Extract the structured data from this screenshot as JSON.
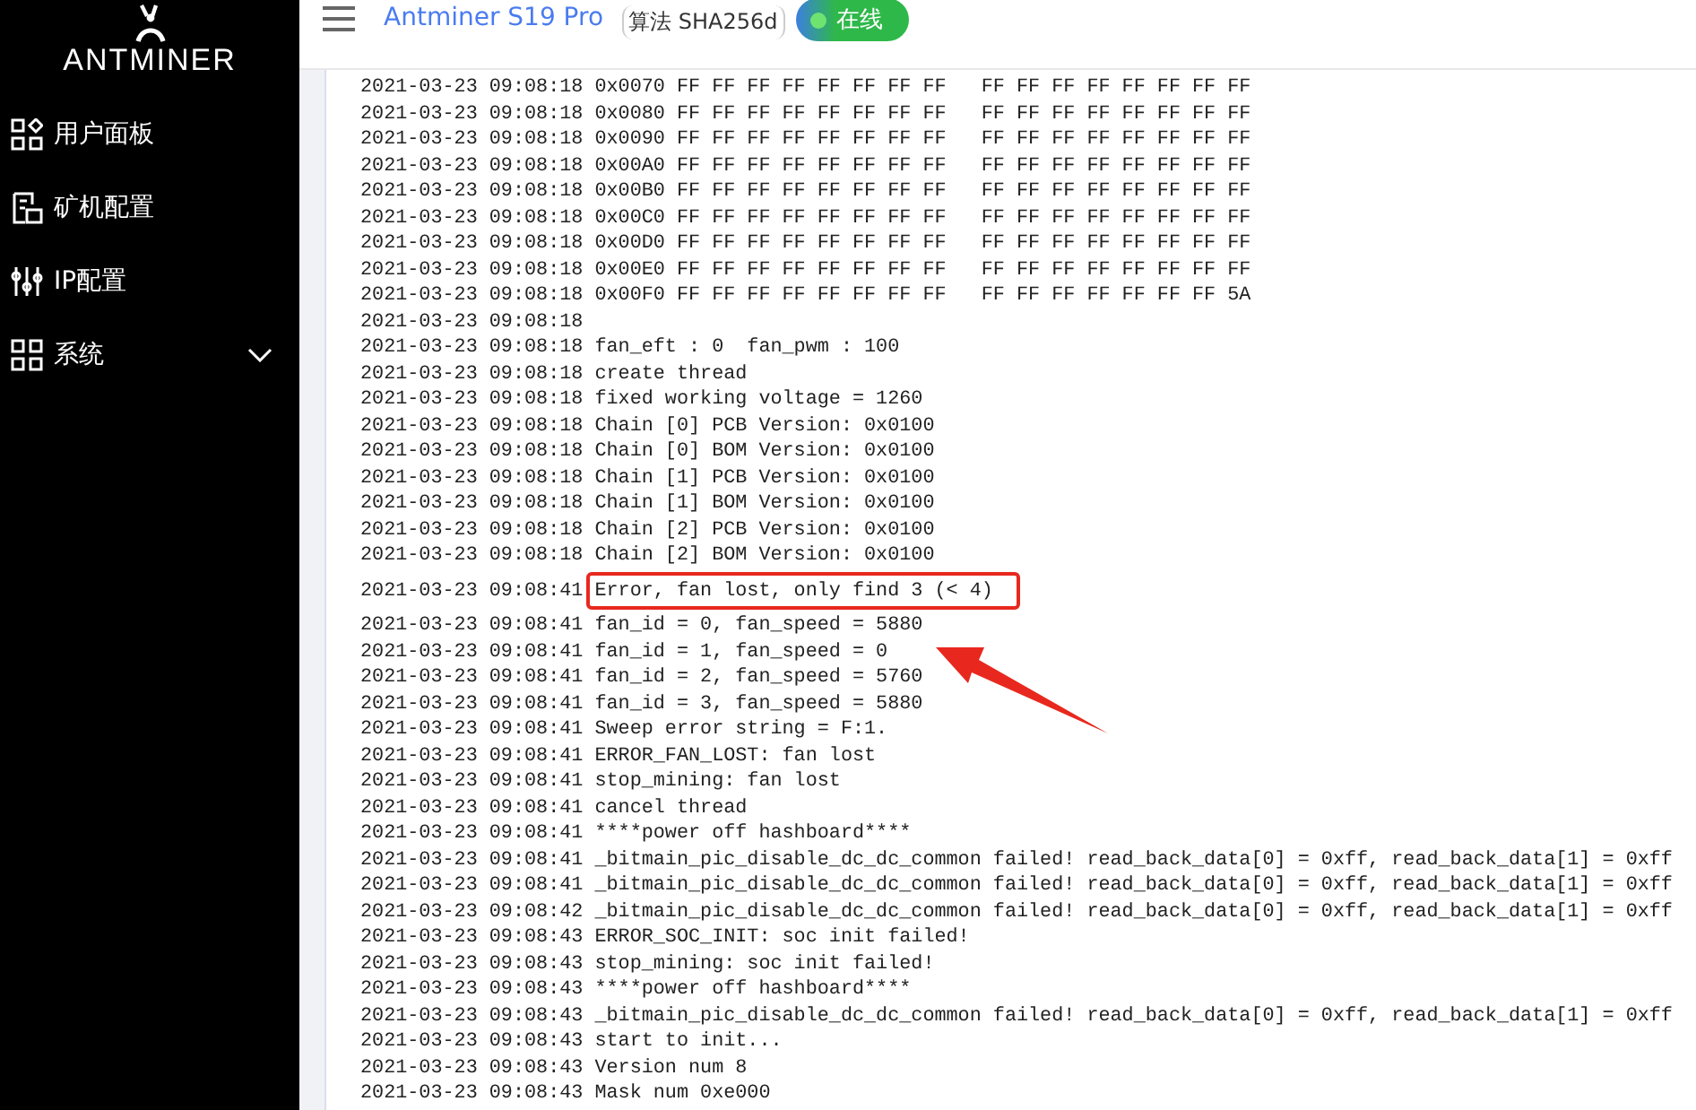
{
  "sidebar": {
    "logo": "ANTMINER",
    "items": [
      {
        "label": "用户面板",
        "kind": "dashboard"
      },
      {
        "label": "矿机配置",
        "kind": "miner"
      },
      {
        "label": "IP配置",
        "kind": "ip"
      },
      {
        "label": "系统",
        "kind": "system",
        "expanded": false
      }
    ]
  },
  "header": {
    "title": "Antminer S19 Pro",
    "algorithm": "算法 SHA256d",
    "status": {
      "label": "在线",
      "online": true
    }
  },
  "log": {
    "lines": [
      {
        "time": "2021-03-23 09:08:18",
        "message": "0x0070 FF FF FF FF FF FF FF FF   FF FF FF FF FF FF FF FF",
        "highlighted": false
      },
      {
        "time": "2021-03-23 09:08:18",
        "message": "0x0080 FF FF FF FF FF FF FF FF   FF FF FF FF FF FF FF FF",
        "highlighted": false
      },
      {
        "time": "2021-03-23 09:08:18",
        "message": "0x0090 FF FF FF FF FF FF FF FF   FF FF FF FF FF FF FF FF",
        "highlighted": false
      },
      {
        "time": "2021-03-23 09:08:18",
        "message": "0x00A0 FF FF FF FF FF FF FF FF   FF FF FF FF FF FF FF FF",
        "highlighted": false
      },
      {
        "time": "2021-03-23 09:08:18",
        "message": "0x00B0 FF FF FF FF FF FF FF FF   FF FF FF FF FF FF FF FF",
        "highlighted": false
      },
      {
        "time": "2021-03-23 09:08:18",
        "message": "0x00C0 FF FF FF FF FF FF FF FF   FF FF FF FF FF FF FF FF",
        "highlighted": false
      },
      {
        "time": "2021-03-23 09:08:18",
        "message": "0x00D0 FF FF FF FF FF FF FF FF   FF FF FF FF FF FF FF FF",
        "highlighted": false
      },
      {
        "time": "2021-03-23 09:08:18",
        "message": "0x00E0 FF FF FF FF FF FF FF FF   FF FF FF FF FF FF FF FF",
        "highlighted": false
      },
      {
        "time": "2021-03-23 09:08:18",
        "message": "0x00F0 FF FF FF FF FF FF FF FF   FF FF FF FF FF FF FF 5A",
        "highlighted": false
      },
      {
        "time": "2021-03-23 09:08:18",
        "highlighted": false
      },
      {
        "time": "2021-03-23 09:08:18",
        "message": "fan_eft : 0  fan_pwm : 100",
        "highlighted": false
      },
      {
        "time": "2021-03-23 09:08:18",
        "message": "create thread",
        "highlighted": false
      },
      {
        "time": "2021-03-23 09:08:18",
        "message": "fixed working voltage = 1260",
        "highlighted": false
      },
      {
        "time": "2021-03-23 09:08:18",
        "message": "Chain [0] PCB Version: 0x0100",
        "highlighted": false
      },
      {
        "time": "2021-03-23 09:08:18",
        "message": "Chain [0] BOM Version: 0x0100",
        "highlighted": false
      },
      {
        "time": "2021-03-23 09:08:18",
        "message": "Chain [1] PCB Version: 0x0100",
        "highlighted": false
      },
      {
        "time": "2021-03-23 09:08:18",
        "message": "Chain [1] BOM Version: 0x0100",
        "highlighted": false
      },
      {
        "time": "2021-03-23 09:08:18",
        "message": "Chain [2] PCB Version: 0x0100",
        "highlighted": false
      },
      {
        "time": "2021-03-23 09:08:18",
        "message": "Chain [2] BOM Version: 0x0100",
        "highlighted": false
      },
      {
        "time": "2021-03-23 09:08:41",
        "message": "Error, fan lost, only find 3 (< 4)",
        "highlighted": true
      },
      {
        "time": "2021-03-23 09:08:41",
        "message": "fan_id = 0, fan_speed = 5880",
        "highlighted": false
      },
      {
        "time": "2021-03-23 09:08:41",
        "message": "fan_id = 1, fan_speed = 0",
        "highlighted": false
      },
      {
        "time": "2021-03-23 09:08:41",
        "message": "fan_id = 2, fan_speed = 5760",
        "highlighted": false
      },
      {
        "time": "2021-03-23 09:08:41",
        "message": "fan_id = 3, fan_speed = 5880",
        "highlighted": false
      },
      {
        "time": "2021-03-23 09:08:41",
        "message": "Sweep error string = F:1.",
        "highlighted": false
      },
      {
        "time": "2021-03-23 09:08:41",
        "message": "ERROR_FAN_LOST: fan lost",
        "highlighted": false
      },
      {
        "time": "2021-03-23 09:08:41",
        "message": "stop_mining: fan lost",
        "highlighted": false
      },
      {
        "time": "2021-03-23 09:08:41",
        "message": "cancel thread",
        "highlighted": false
      },
      {
        "time": "2021-03-23 09:08:41",
        "message": "****power off hashboard****",
        "highlighted": false
      },
      {
        "time": "2021-03-23 09:08:41",
        "message": "_bitmain_pic_disable_dc_dc_common failed! read_back_data[0] = 0xff, read_back_data[1] = 0xff",
        "highlighted": false
      },
      {
        "time": "2021-03-23 09:08:41",
        "message": "_bitmain_pic_disable_dc_dc_common failed! read_back_data[0] = 0xff, read_back_data[1] = 0xff",
        "highlighted": false
      },
      {
        "time": "2021-03-23 09:08:42",
        "message": "_bitmain_pic_disable_dc_dc_common failed! read_back_data[0] = 0xff, read_back_data[1] = 0xff",
        "highlighted": false
      },
      {
        "time": "2021-03-23 09:08:43",
        "message": "ERROR_SOC_INIT: soc init failed!",
        "highlighted": false
      },
      {
        "time": "2021-03-23 09:08:43",
        "message": "stop_mining: soc init failed!",
        "highlighted": false
      },
      {
        "time": "2021-03-23 09:08:43",
        "message": "****power off hashboard****",
        "highlighted": false
      },
      {
        "time": "2021-03-23 09:08:43",
        "message": "_bitmain_pic_disable_dc_dc_common failed! read_back_data[0] = 0xff, read_back_data[1] = 0xff",
        "highlighted": false
      },
      {
        "time": "2021-03-23 09:08:43",
        "message": "start to init...",
        "highlighted": false
      },
      {
        "time": "2021-03-23 09:08:43",
        "message": "Version num 8",
        "highlighted": false
      },
      {
        "time": "2021-03-23 09:08:43",
        "message": "Mask num 0xe000",
        "highlighted": false
      }
    ]
  }
}
